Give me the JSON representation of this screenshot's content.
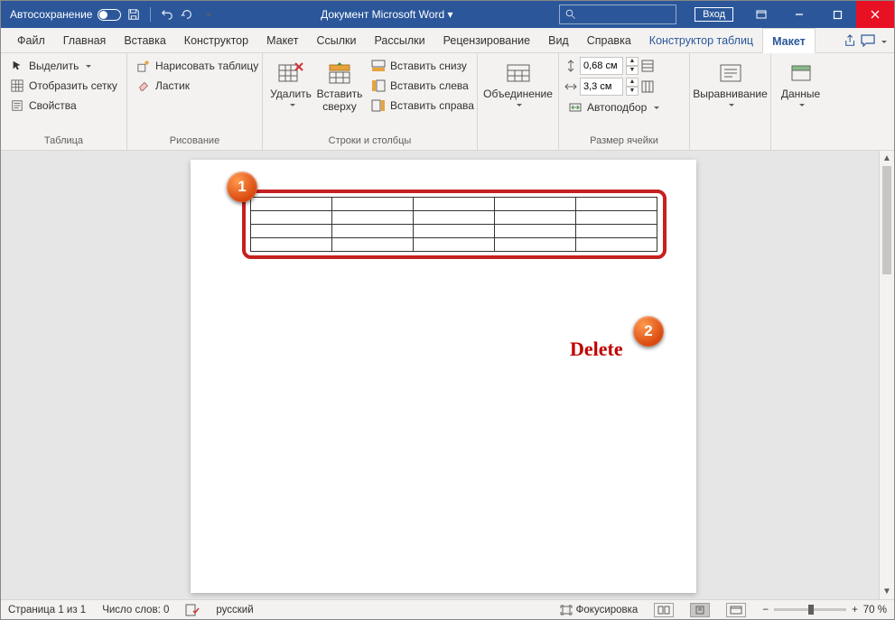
{
  "titlebar": {
    "autosave_label": "Автосохранение",
    "doc_title": "Документ Microsoft Word ▾",
    "signin": "Вход"
  },
  "tabs": {
    "file": "Файл",
    "home": "Главная",
    "insert": "Вставка",
    "design": "Конструктор",
    "layout": "Макет",
    "references": "Ссылки",
    "mailings": "Рассылки",
    "review": "Рецензирование",
    "view": "Вид",
    "help": "Справка",
    "tabledesign": "Конструктор таблиц",
    "tablelayout": "Макет"
  },
  "ribbon": {
    "g1": {
      "select": "Выделить",
      "gridlines": "Отобразить сетку",
      "properties": "Свойства",
      "label": "Таблица"
    },
    "g2": {
      "draw": "Нарисовать таблицу",
      "eraser": "Ластик",
      "label": "Рисование"
    },
    "g3": {
      "delete": "Удалить",
      "insert_above": "Вставить сверху",
      "insert_below": "Вставить снизу",
      "insert_left": "Вставить слева",
      "insert_right": "Вставить справа",
      "label": "Строки и столбцы"
    },
    "g4": {
      "merge": "Объединение",
      "label": ""
    },
    "g5": {
      "height": "0,68 см",
      "width": "3,3 см",
      "autofit": "Автоподбор",
      "label": "Размер ячейки"
    },
    "g6": {
      "align": "Выравнивание",
      "label": ""
    },
    "g7": {
      "data": "Данные",
      "label": ""
    }
  },
  "annotations": {
    "n1": "1",
    "n2": "2",
    "delete_text": "Delete"
  },
  "status": {
    "page": "Страница 1 из 1",
    "words": "Число слов: 0",
    "lang": "русский",
    "focus": "Фокусировка",
    "zoom": "70 %"
  }
}
